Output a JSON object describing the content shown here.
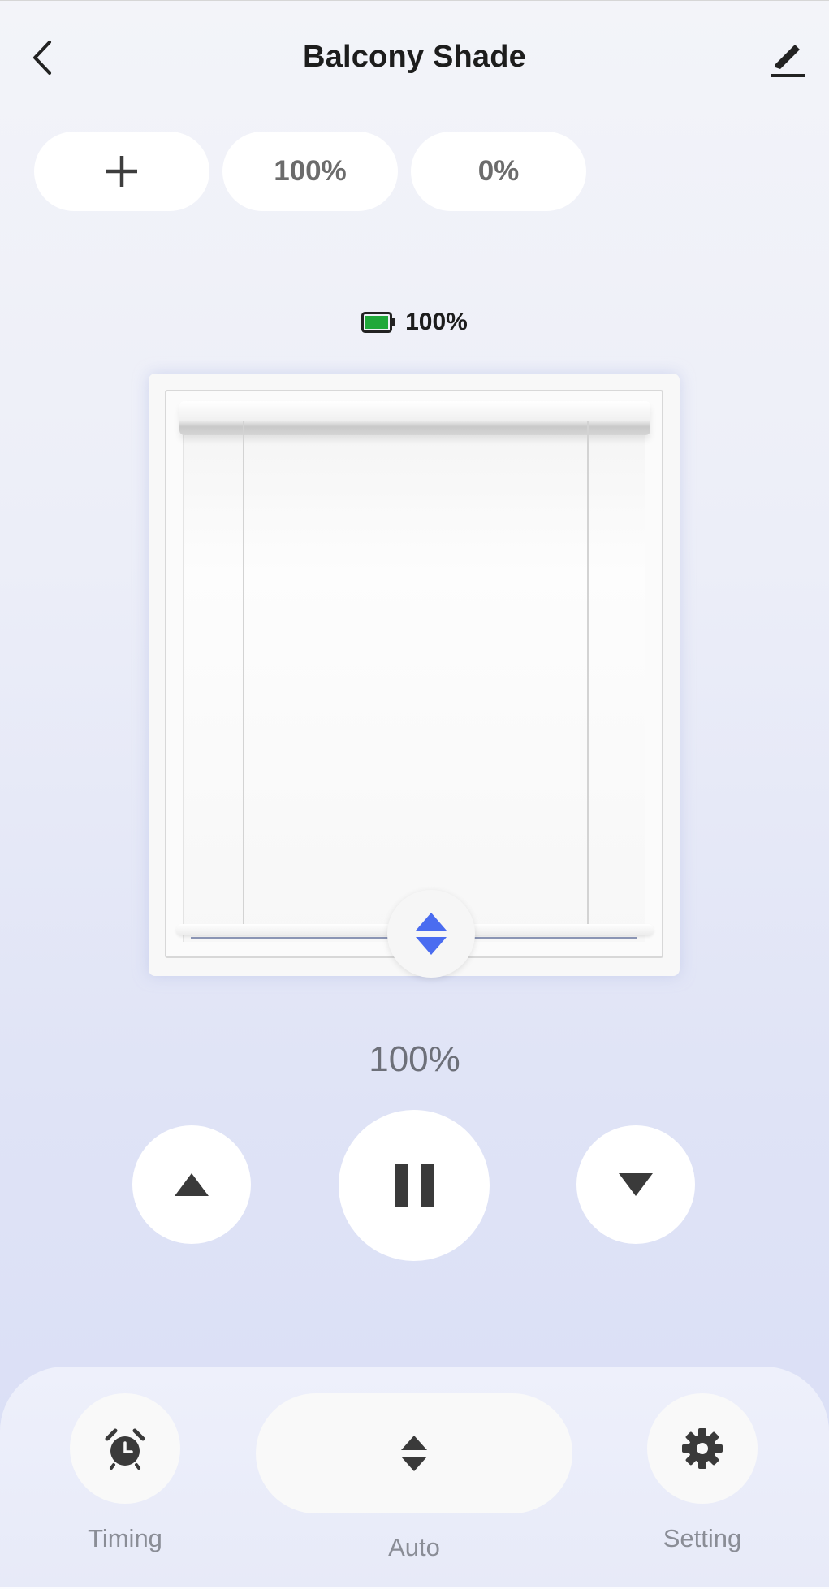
{
  "header": {
    "title": "Balcony Shade",
    "back_icon": "chevron-left-icon",
    "edit_icon": "pencil-icon"
  },
  "presets": [
    {
      "label": "",
      "icon": "plus-icon"
    },
    {
      "label": "100%"
    },
    {
      "label": "0%"
    }
  ],
  "battery": {
    "label": "100%",
    "icon": "battery-icon",
    "level": 1.0,
    "color": "#1fa83a"
  },
  "shade": {
    "position_label": "100%",
    "handle_icon": "up-down-arrows-icon",
    "handle_color": "#4a6cf0"
  },
  "controls": {
    "up_icon": "triangle-up-icon",
    "pause_icon": "pause-icon",
    "down_icon": "triangle-down-icon"
  },
  "bottom_bar": {
    "timing_label": "Timing",
    "auto_label": "Auto",
    "setting_label": "Setting"
  }
}
